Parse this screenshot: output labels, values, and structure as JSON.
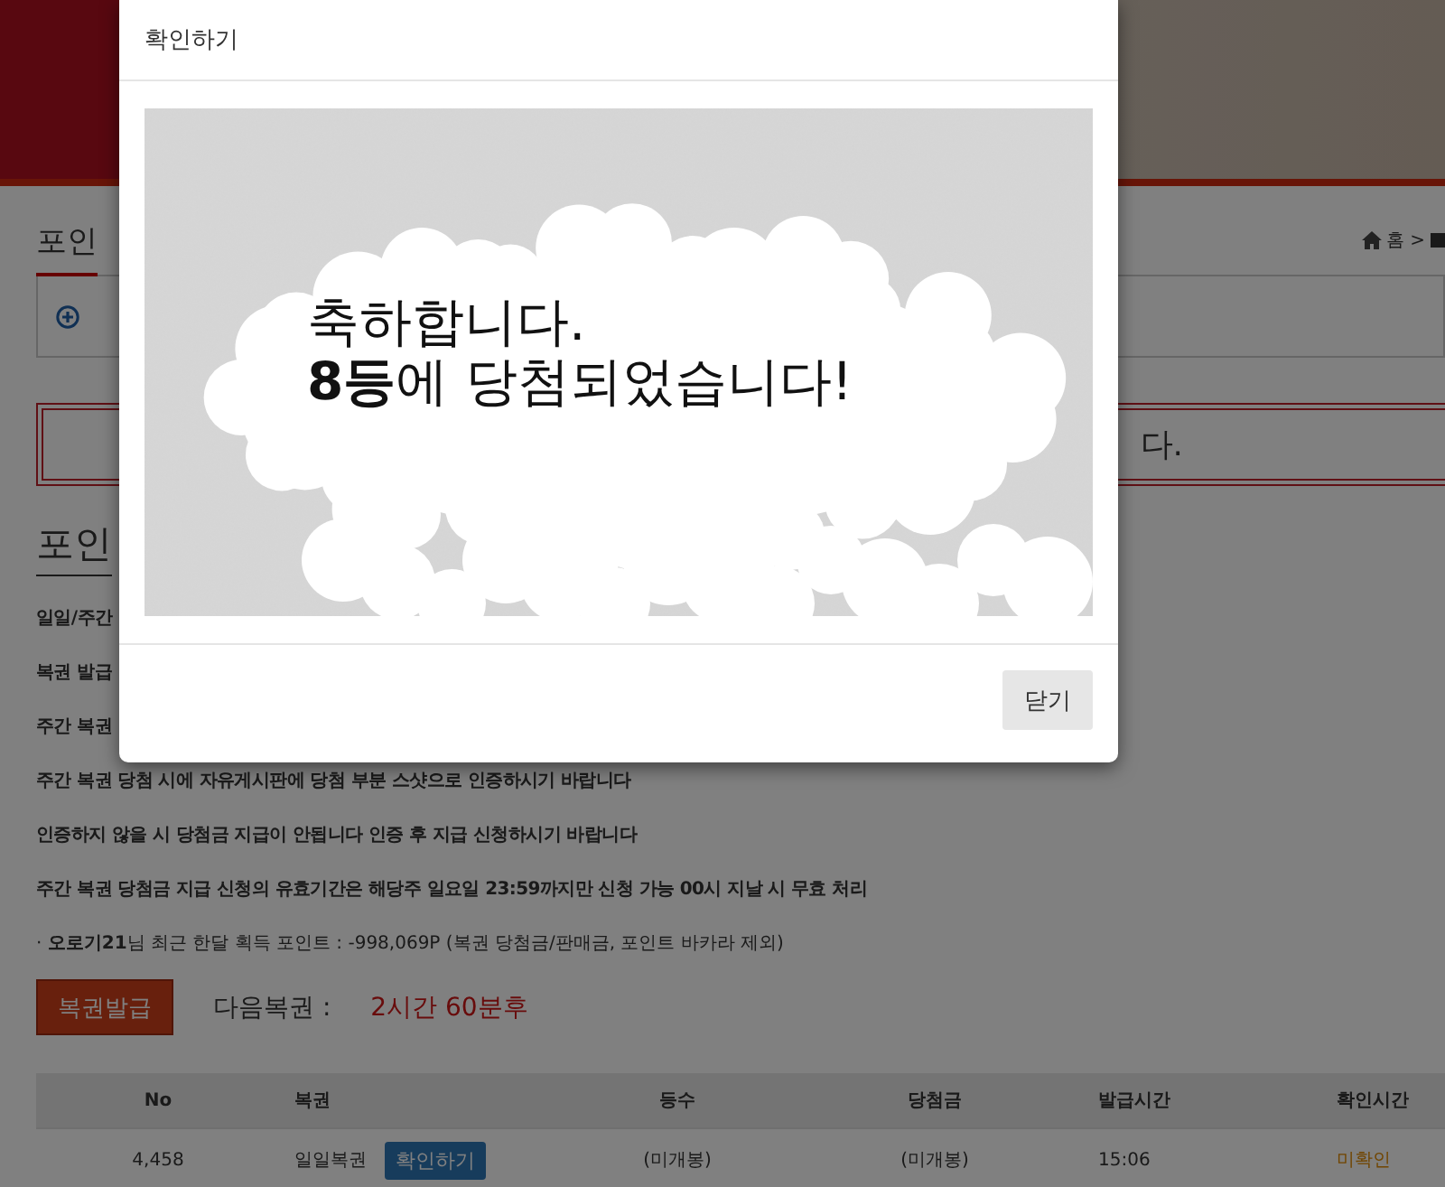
{
  "page": {
    "title": "포인",
    "breadcrumb": [
      "홈",
      ">"
    ],
    "notice": "다.",
    "heading": "포인",
    "rules": [
      "일일/주간",
      "복권 발급",
      "주간 복권",
      "주간 복권 당첨 시에 자유게시판에 당첨 부분 스샷으로 인증하시기 바랍니다",
      "인증하지 않을 시 당첨금 지급이 안됩니다 인증 후 지급 신청하시기 바랍니다",
      "주간 복권 당첨금 지급 신청의 유효기간은 해당주 일요일 **23:59**까지만 신청 가능 **00**시 지날 시 무효 처리"
    ],
    "points_line": "· **오로기21**님 최근 한달 획득 포인트 : -998,069P (복권 당첨금/판매금, 포인트 바카라 제외)",
    "issue_button": "복권발급",
    "next_label": "다음복권 :",
    "next_time": "2시간 60분후"
  },
  "table": {
    "columns": [
      "No",
      "복권",
      "등수",
      "당첨금",
      "발급시간",
      "확인시간"
    ],
    "rows": [
      {
        "no": "4,458",
        "ticket": "일일복권",
        "action": "확인하기",
        "rank": "(미개봉)",
        "prize": "(미개봉)",
        "issued": "15:06",
        "status": "미확인"
      }
    ]
  },
  "modal": {
    "title": "확인하기",
    "message": [
      "축하합니다.",
      "**8등**에 당첨되었습니다!"
    ],
    "close_button": "닫기"
  }
}
